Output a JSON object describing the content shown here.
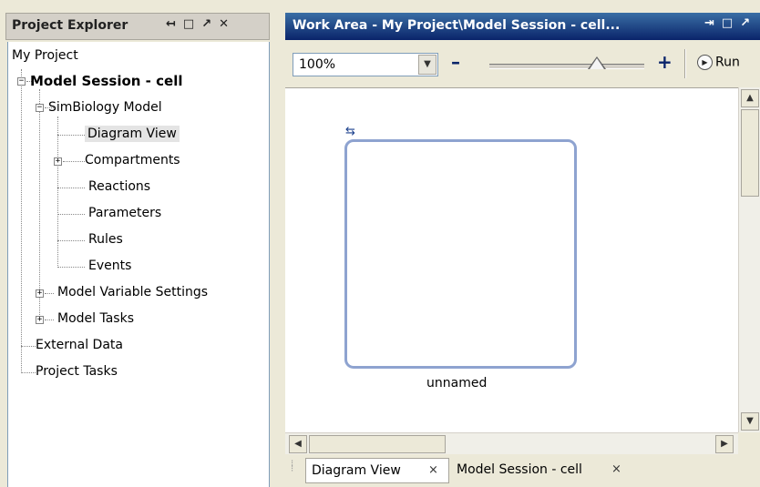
{
  "project_explorer": {
    "title": "Project Explorer",
    "controls": [
      "↤",
      "□",
      "↗",
      "✕"
    ],
    "tree": {
      "root": "My Project",
      "session": "Model Session - cell",
      "model": "SimBiology Model",
      "model_items": [
        "Diagram View",
        "Compartments",
        "Reactions",
        "Parameters",
        "Rules",
        "Events"
      ],
      "session_items": [
        "Model Variable Settings",
        "Model Tasks"
      ],
      "project_items": [
        "External Data",
        "Project Tasks"
      ],
      "selected": "Diagram View"
    }
  },
  "work_area": {
    "title": "Work Area - My Project\\Model Session - cell...",
    "controls": [
      "⇥",
      "□",
      "↗"
    ],
    "toolbar": {
      "zoom_value": "100%",
      "zoom_out": "–",
      "zoom_in": "+",
      "zoom_slider_fraction": 0.65,
      "run_label": "Run"
    },
    "diagram": {
      "compartment_label": "unnamed",
      "cycle_icon": "⇆"
    },
    "tabs": [
      {
        "label": "Diagram View",
        "active": true
      },
      {
        "label": "Model Session - cell",
        "active": false
      }
    ],
    "tab_close": "×"
  },
  "colors": {
    "title_bar": "#0a246a",
    "compartment_border": "#8ea3d0",
    "window_bg": "#ece9d8"
  }
}
